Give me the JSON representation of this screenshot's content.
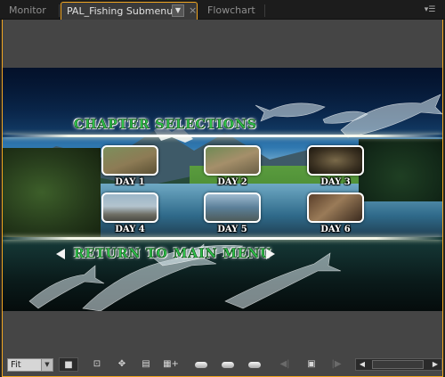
{
  "tabs": [
    {
      "label": "Monitor"
    },
    {
      "label": "PAL_Fishing Submenu"
    },
    {
      "label": "Flowchart"
    }
  ],
  "tab_icons": {
    "dropdown": "chevron-down-icon",
    "close": "close-icon",
    "panel_menu": "panel-menu-icon"
  },
  "menu": {
    "chapter_title": "CHAPTER SELECTIONS",
    "return_title": "RETURN TO MAIN MENU",
    "days": [
      {
        "label": "DAY 1"
      },
      {
        "label": "DAY 2"
      },
      {
        "label": "DAY 3"
      },
      {
        "label": "DAY 4"
      },
      {
        "label": "DAY 5"
      },
      {
        "label": "DAY 6"
      }
    ]
  },
  "toolbar": {
    "zoom_value": "Fit",
    "zoom_icon": "chevron-down-icon"
  },
  "colors": {
    "accent": "#f0a521",
    "heading_green": "#2ec24a",
    "panel_bg": "#454545"
  }
}
